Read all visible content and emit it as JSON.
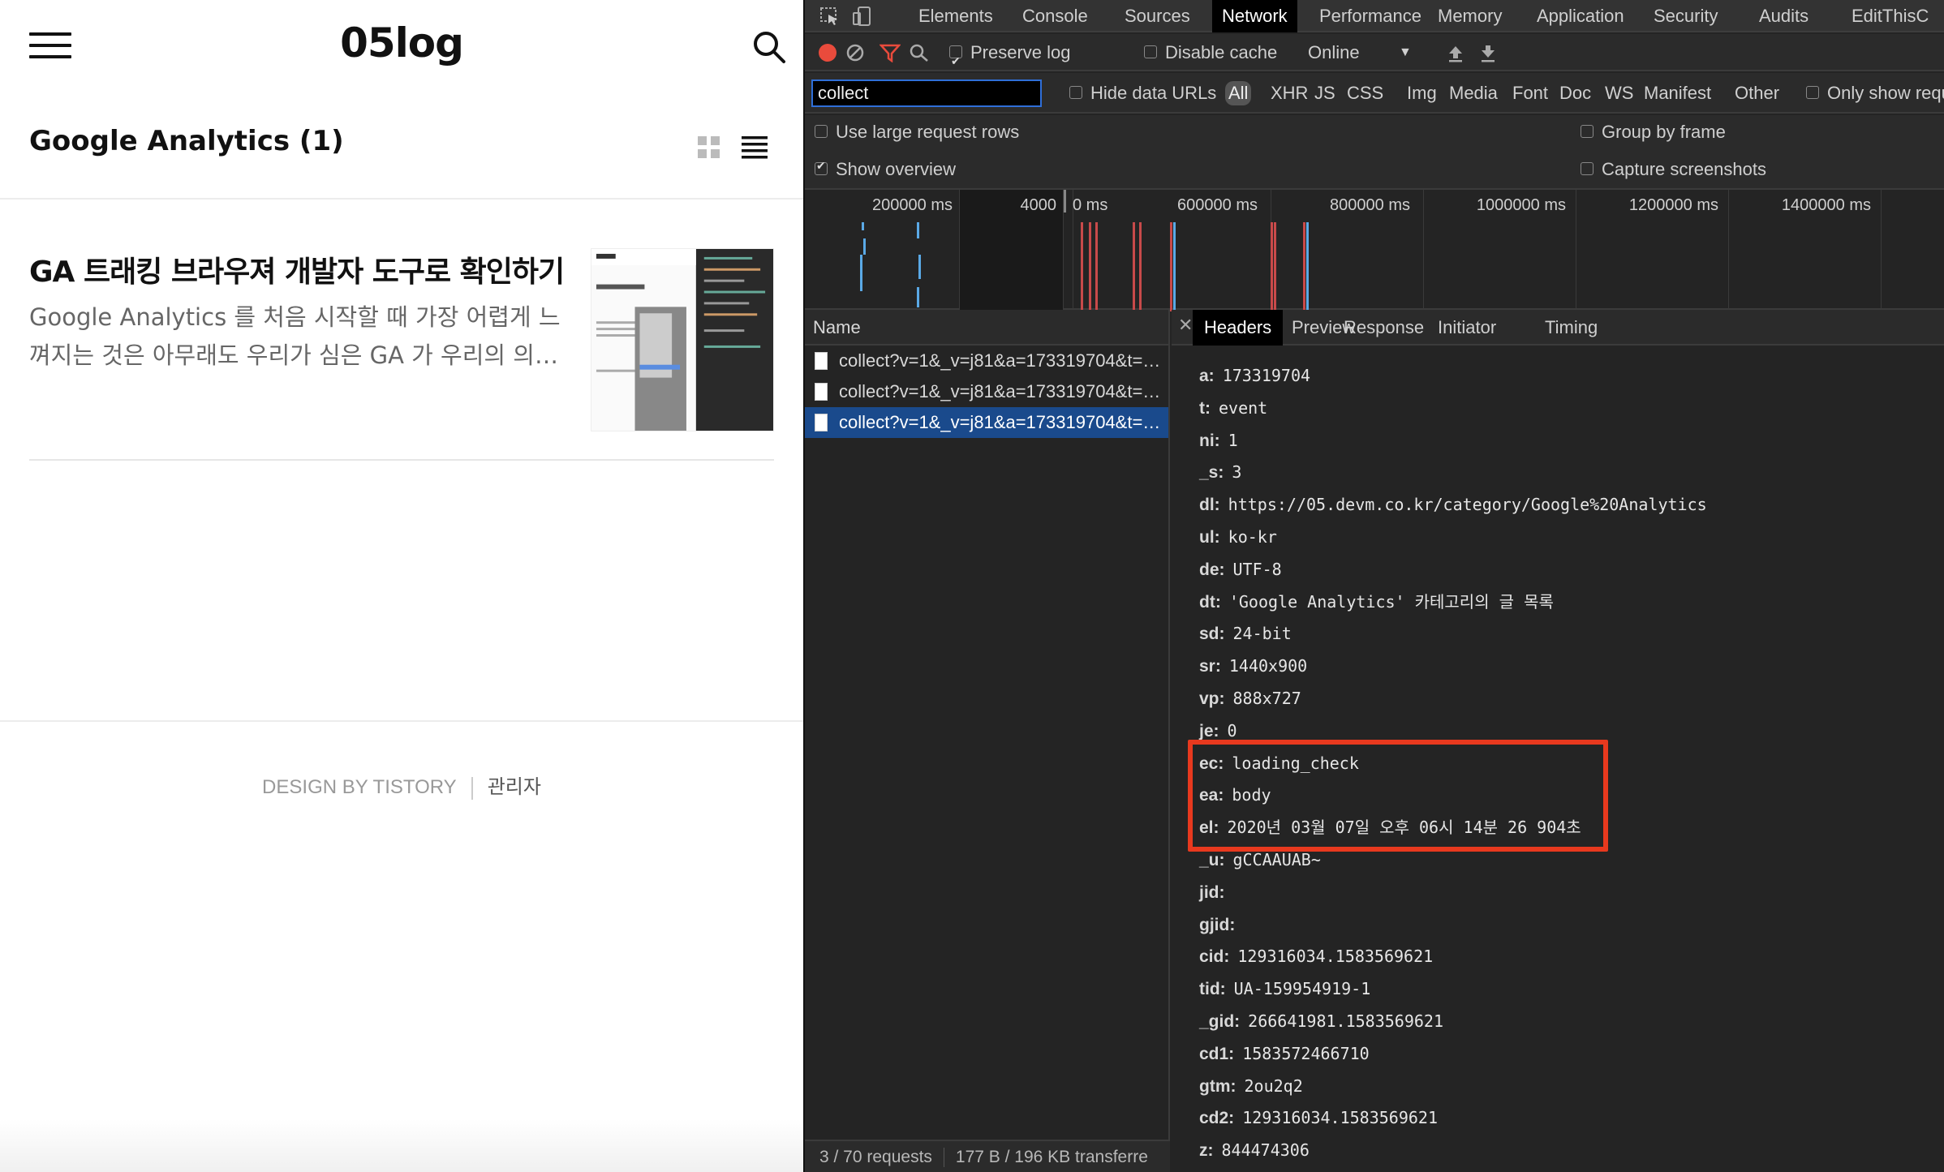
{
  "blog": {
    "site_title": "05log",
    "category_title": "Google Analytics (1)",
    "post": {
      "title": "GA 트래킹 브라우져 개발자 도구로 확인하기",
      "excerpt": "Google Analytics 를 처음 시작할 때 가장 어렵게 느껴지는 것은 아무래도 우리가 심은 GA 가 우리의 의…"
    },
    "footer": {
      "design": "DESIGN BY TISTORY",
      "admin": "관리자"
    }
  },
  "devtools": {
    "main_tabs": [
      "Elements",
      "Console",
      "Sources",
      "Network",
      "Performance",
      "Memory",
      "Application",
      "Security",
      "Audits",
      "EditThisC"
    ],
    "active_tab": "Network",
    "toolbar": {
      "preserve_log": "Preserve log",
      "disable_cache": "Disable cache",
      "throttle": "Online"
    },
    "filter": {
      "value": "collect",
      "hide_data_urls": "Hide data URLs",
      "types": [
        "All",
        "XHR",
        "JS",
        "CSS",
        "Img",
        "Media",
        "Font",
        "Doc",
        "WS",
        "Manifest",
        "Other"
      ],
      "only_show": "Only show requ"
    },
    "options": {
      "large_rows": "Use large request rows",
      "show_overview": "Show overview",
      "group_by_frame": "Group by frame",
      "capture_screenshots": "Capture screenshots"
    },
    "overview_ticks": [
      "200000 ms",
      "4000",
      "0 ms",
      "600000 ms",
      "800000 ms",
      "1000000 ms",
      "1200000 ms",
      "1400000 ms"
    ],
    "names_header": "Name",
    "requests": [
      "collect?v=1&_v=j81&a=173319704&t=…",
      "collect?v=1&_v=j81&a=173319704&t=…",
      "collect?v=1&_v=j81&a=173319704&t=…"
    ],
    "status": {
      "requests": "3 / 70 requests",
      "transferred": "177 B / 196 KB transferre"
    },
    "detail_tabs": [
      "Headers",
      "Preview",
      "Response",
      "Initiator",
      "Timing"
    ],
    "params": [
      {
        "k": "a:",
        "v": "173319704"
      },
      {
        "k": "t:",
        "v": "event"
      },
      {
        "k": "ni:",
        "v": "1"
      },
      {
        "k": "_s:",
        "v": "3"
      },
      {
        "k": "dl:",
        "v": "https://05.devm.co.kr/category/Google%20Analytics"
      },
      {
        "k": "ul:",
        "v": "ko-kr"
      },
      {
        "k": "de:",
        "v": "UTF-8"
      },
      {
        "k": "dt:",
        "v": "'Google Analytics' 카테고리의 글 목록"
      },
      {
        "k": "sd:",
        "v": "24-bit"
      },
      {
        "k": "sr:",
        "v": "1440x900"
      },
      {
        "k": "vp:",
        "v": "888x727"
      },
      {
        "k": "je:",
        "v": "0"
      },
      {
        "k": "ec:",
        "v": "loading_check"
      },
      {
        "k": "ea:",
        "v": "body"
      },
      {
        "k": "el:",
        "v": "2020년 03월 07일 오후 06시 14분 26 904초"
      },
      {
        "k": "_u:",
        "v": "gCCAAUAB~"
      },
      {
        "k": "jid:",
        "v": ""
      },
      {
        "k": "gjid:",
        "v": ""
      },
      {
        "k": "cid:",
        "v": "129316034.1583569621"
      },
      {
        "k": "tid:",
        "v": "UA-159954919-1"
      },
      {
        "k": "_gid:",
        "v": "266641981.1583569621"
      },
      {
        "k": "cd1:",
        "v": "1583572466710"
      },
      {
        "k": "gtm:",
        "v": "2ou2q2"
      },
      {
        "k": "cd2:",
        "v": "129316034.1583569621"
      },
      {
        "k": "z:",
        "v": "844474306"
      }
    ],
    "colors": {
      "highlight_box": "#e8391e",
      "selected_row": "#1a4a8c",
      "record_button": "#e94b3c",
      "filter_icon": "#e94b3c"
    }
  }
}
